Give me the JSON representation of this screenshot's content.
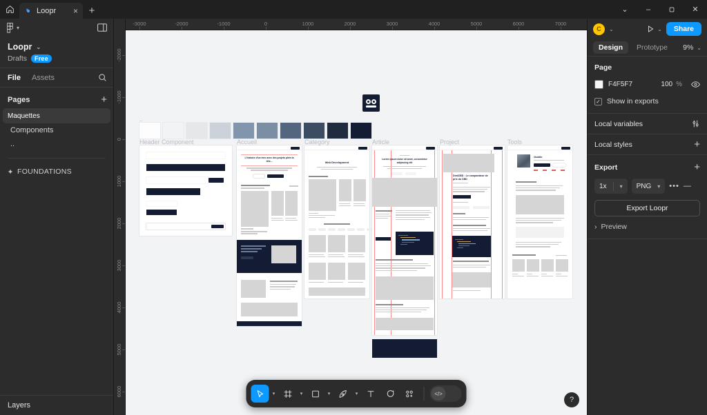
{
  "window": {
    "home_icon": "home-icon",
    "tab_title": "Loopr",
    "tab_favicon": "figma-icon",
    "tab_close": "×",
    "new_tab": "+",
    "controls": {
      "chevron": "⌄",
      "minimize": "–",
      "restore": "❐",
      "close": "✕"
    }
  },
  "left_panel": {
    "menu_icon": "figma-menu-icon",
    "panel_toggle_icon": "panel-toggle-icon",
    "file_name": "Loopr",
    "file_chevron": "⌄",
    "location": "Drafts",
    "plan_badge": "Free",
    "tabs": [
      {
        "label": "File",
        "active": true
      },
      {
        "label": "Assets",
        "active": false
      }
    ],
    "search_icon": "search-icon",
    "pages_title": "Pages",
    "pages_add": "+",
    "pages": [
      {
        "label": "Maquettes",
        "selected": true
      },
      {
        "label": "Components",
        "selected": false
      },
      {
        "label": "..",
        "selected": false
      }
    ],
    "foundations_label": "FOUNDATIONS",
    "foundations_icon": "diamond-icon",
    "layers_label": "Layers"
  },
  "rulers": {
    "horizontal": [
      "-3000",
      "-2000",
      "-1000",
      "0",
      "1000",
      "2000",
      "3000",
      "4000",
      "5000",
      "6000",
      "7000"
    ],
    "vertical": [
      "-2000",
      "-1000",
      "0",
      "1000",
      "2000",
      "3000",
      "4000",
      "5000",
      "6000"
    ]
  },
  "canvas": {
    "background": "#f2f3f5",
    "logo_name": "loopr-logo",
    "palette": [
      "#fdfdfd",
      "#f2f3f4",
      "#e6e7e9",
      "#ccd2da",
      "#8196ad",
      "#7c8ea3",
      "#54657e",
      "#3c4c63",
      "#202b40",
      "#131c32"
    ],
    "frames": [
      {
        "label": "Header Component"
      },
      {
        "label": "Accueil"
      },
      {
        "label": "Category"
      },
      {
        "label": "Article"
      },
      {
        "label": "Project"
      },
      {
        "label": "Tools"
      }
    ],
    "frame_text": {
      "accueil_headline": "L'histoire d'un mec avec des projets plein la tête...",
      "category_headline": "Web Development",
      "article_headline": "Lorem ipsum dolor sit amet, consectetur adipiscing elit",
      "project_headline": "DealCBD : Le comparateur de prix du CBD",
      "tools_headline": "Oublie"
    }
  },
  "right_panel": {
    "avatar_initial": "C",
    "avatar_chevron": "⌄",
    "present_icon": "play-icon",
    "present_chevron": "⌄",
    "share_label": "Share",
    "tabs": [
      {
        "label": "Design",
        "active": true
      },
      {
        "label": "Prototype",
        "active": false
      }
    ],
    "zoom_level": "9%",
    "zoom_chevron": "⌄",
    "page_section": {
      "title": "Page",
      "color_hex": "F4F5F7",
      "opacity": "100",
      "opacity_unit": "%",
      "visibility_icon": "eye-icon",
      "checkbox_label": "Show in exports",
      "checkbox_checked": true
    },
    "local_variables": {
      "label": "Local variables",
      "icon": "sliders-icon"
    },
    "local_styles": {
      "label": "Local styles",
      "icon": "plus-icon"
    },
    "export": {
      "title": "Export",
      "add_icon": "plus-icon",
      "scale": "1x",
      "scale_chevron": "⌄",
      "format": "PNG",
      "format_chevron": "⌄",
      "more_icon": "ellipsis-icon",
      "remove_icon": "minus-icon",
      "button_label": "Export Loopr",
      "preview_label": "Preview",
      "preview_chevron": "›"
    }
  },
  "toolbar": {
    "tools": [
      {
        "name": "move-tool",
        "glyph": "cursor",
        "active": true,
        "has_chevron": true
      },
      {
        "name": "frame-tool",
        "glyph": "frame",
        "active": false,
        "has_chevron": true
      },
      {
        "name": "shape-tool",
        "glyph": "square",
        "active": false,
        "has_chevron": true
      },
      {
        "name": "pen-tool",
        "glyph": "pen",
        "active": false,
        "has_chevron": true
      },
      {
        "name": "text-tool",
        "glyph": "T",
        "active": false,
        "has_chevron": false
      },
      {
        "name": "comment-tool",
        "glyph": "comment",
        "active": false,
        "has_chevron": false
      },
      {
        "name": "actions-tool",
        "glyph": "plugins",
        "active": false,
        "has_chevron": false
      }
    ],
    "dev_mode_icon": "code-icon"
  },
  "help_button": {
    "label": "?"
  },
  "colors": {
    "accent": "#0d99ff",
    "panel": "#2c2c2c",
    "canvas": "#f2f3f5",
    "ink": "#131c32",
    "avatar": "#ffc700"
  }
}
